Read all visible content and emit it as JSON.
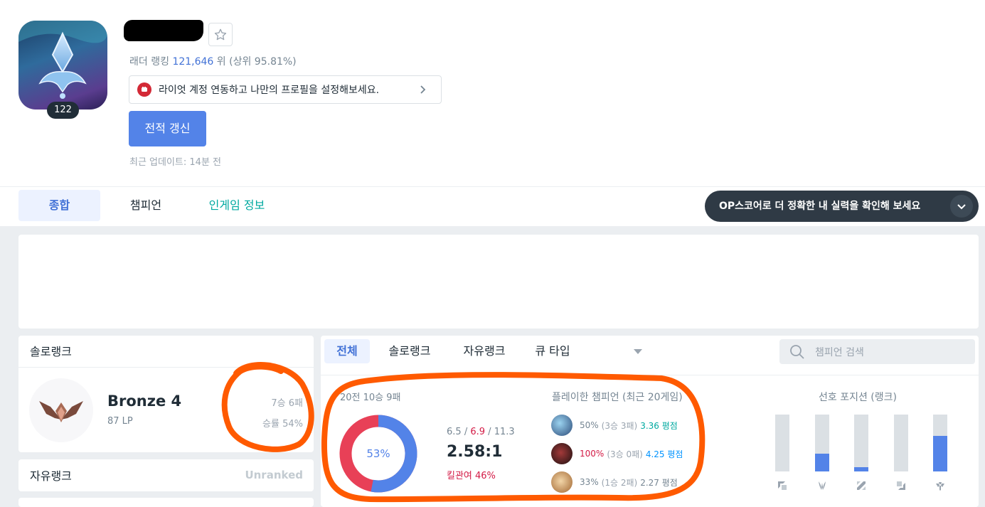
{
  "profile": {
    "level": "122",
    "ladder_label": "래더 랭킹",
    "ladder_rank": "121,646",
    "ladder_suffix": "위 (상위 95.81%)",
    "riot_banner_text": "라이엇 계정 연동하고 나만의 프로필을 설정해보세요.",
    "refresh_label": "전적 갱신",
    "last_update": "최근 업데이트: 14분 전"
  },
  "nav": {
    "tabs": [
      {
        "label": "종합"
      },
      {
        "label": "챔피언"
      },
      {
        "label": "인게임 정보"
      }
    ],
    "op_pill_text": "OP스코어로 더 정확한 내 실력을 확인해 보세요"
  },
  "solo_rank": {
    "title": "솔로랭크",
    "tier": "Bronze 4",
    "lp": "87 LP",
    "record": "7승 6패",
    "winrate": "승률 54%"
  },
  "flex_rank": {
    "title": "자유랭크",
    "status": "Unranked"
  },
  "filters": {
    "tabs": [
      {
        "label": "전체"
      },
      {
        "label": "솔로랭크"
      },
      {
        "label": "자유랭크"
      },
      {
        "label": "큐 타입"
      }
    ],
    "search_placeholder": "챔피언 검색"
  },
  "summary": {
    "games": "20전 10승 9패",
    "winrate_pct": "53%",
    "winrate_value": 53,
    "kills": "6.5",
    "deaths": "6.9",
    "assists": "11.3",
    "kda_ratio": "2.58:1",
    "kill_participation": "킬관여 46%"
  },
  "played_champions": {
    "title": "플레이한 챔피언 (최근 20게임)",
    "rows": [
      {
        "winrate": "50%",
        "record": "(3승 3패)",
        "kda": "3.36 평점",
        "wr_color": "gray",
        "kda_color": "teal"
      },
      {
        "winrate": "100%",
        "record": "(3승 0패)",
        "kda": "4.25 평점",
        "wr_color": "red",
        "kda_color": "blue"
      },
      {
        "winrate": "33%",
        "record": "(1승 2패)",
        "kda": "2.27 평점",
        "wr_color": "gray",
        "kda_color": "gray"
      }
    ]
  },
  "positions": {
    "title": "선호 포지션 (랭크)",
    "items": [
      {
        "icon": "top-icon",
        "share": 0
      },
      {
        "icon": "jungle-icon",
        "share": 0.31
      },
      {
        "icon": "mid-icon",
        "share": 0.07
      },
      {
        "icon": "adc-icon",
        "share": 0
      },
      {
        "icon": "support-icon",
        "share": 0.62
      }
    ]
  },
  "colors": {
    "accent": "#5383e8",
    "loss": "#e84057",
    "annotation": "#ff5a00"
  }
}
